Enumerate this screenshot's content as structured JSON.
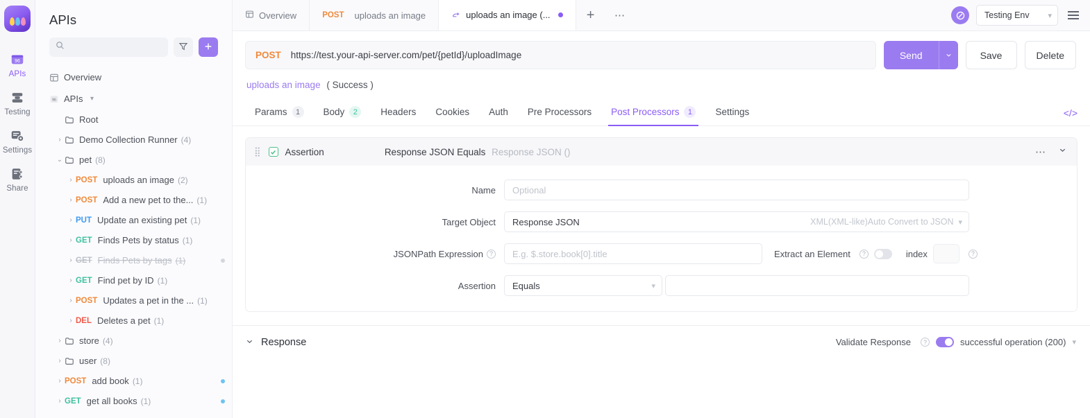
{
  "rail": {
    "items": [
      {
        "label": "APIs",
        "icon": "apis-icon",
        "active": true
      },
      {
        "label": "Testing",
        "icon": "testing-icon",
        "active": false
      },
      {
        "label": "Settings",
        "icon": "settings-icon",
        "active": false
      },
      {
        "label": "Share",
        "icon": "share-icon",
        "active": false
      }
    ]
  },
  "sidebar": {
    "title": "APIs",
    "search_placeholder": "",
    "filter_label": "filter",
    "add_label": "+",
    "overview_label": "Overview",
    "apis_label": "APIs",
    "tree": [
      {
        "label": "Root",
        "count": "",
        "method": "",
        "indent": 0,
        "caret": "",
        "folder": true
      },
      {
        "label": "Demo Collection Runner",
        "count": "(4)",
        "method": "",
        "indent": 0,
        "caret": "›",
        "folder": true
      },
      {
        "label": "pet",
        "count": "(8)",
        "method": "",
        "indent": 0,
        "caret": "⌄",
        "folder": true
      },
      {
        "label": "uploads an image",
        "count": "(2)",
        "method": "POST",
        "indent": 1,
        "caret": "›"
      },
      {
        "label": "Add a new pet to the...",
        "count": "(1)",
        "method": "POST",
        "indent": 1,
        "caret": "›"
      },
      {
        "label": "Update an existing pet",
        "count": "(1)",
        "method": "PUT",
        "indent": 1,
        "caret": "›"
      },
      {
        "label": "Finds Pets by status",
        "count": "(1)",
        "method": "GET",
        "indent": 1,
        "caret": "›"
      },
      {
        "label": "Finds Pets by tags",
        "count": "(1)",
        "method": "GET",
        "indent": 1,
        "caret": "›",
        "muted": true,
        "dot": "grey"
      },
      {
        "label": "Find pet by ID",
        "count": "(1)",
        "method": "GET",
        "indent": 1,
        "caret": "›"
      },
      {
        "label": "Updates a pet in the ...",
        "count": "(1)",
        "method": "POST",
        "indent": 1,
        "caret": "›"
      },
      {
        "label": "Deletes a pet",
        "count": "(1)",
        "method": "DEL",
        "indent": 1,
        "caret": "›"
      },
      {
        "label": "store",
        "count": "(4)",
        "method": "",
        "indent": 0,
        "caret": "›",
        "folder": true
      },
      {
        "label": "user",
        "count": "(8)",
        "method": "",
        "indent": 0,
        "caret": "›",
        "folder": true
      },
      {
        "label": "add book",
        "count": "(1)",
        "method": "POST",
        "indent": 0,
        "caret": "›",
        "dot": "blue"
      },
      {
        "label": "get all books",
        "count": "(1)",
        "method": "GET",
        "indent": 0,
        "caret": "›",
        "dot": "blue"
      }
    ]
  },
  "tabs": {
    "items": [
      {
        "label": "Overview",
        "method": "",
        "icon": "overview-icon",
        "active": false,
        "dirty": false
      },
      {
        "label": "uploads an image",
        "method": "POST",
        "icon": "",
        "active": false,
        "dirty": false
      },
      {
        "label": "uploads an image (...",
        "method": "",
        "icon": "test-case-icon",
        "active": true,
        "dirty": true
      }
    ],
    "new_tab_label": "+",
    "more_label": "⋯"
  },
  "topbar": {
    "env_name": "Testing Env",
    "env_caret": "⌄",
    "menu_label": "menu"
  },
  "request": {
    "method": "POST",
    "url": "https://test.your-api-server.com/pet/{petId}/uploadImage",
    "send_label": "Send",
    "send_caret": "⌄",
    "save_label": "Save",
    "delete_label": "Delete"
  },
  "breadcrumb": {
    "link": "uploads an image",
    "suffix": "( Success )"
  },
  "section_tabs": {
    "items": [
      {
        "label": "Params",
        "badge": "1",
        "badge_style": "grey",
        "active": false
      },
      {
        "label": "Body",
        "badge": "2",
        "badge_style": "green",
        "active": false
      },
      {
        "label": "Headers",
        "badge": "",
        "badge_style": "",
        "active": false
      },
      {
        "label": "Cookies",
        "badge": "",
        "badge_style": "",
        "active": false
      },
      {
        "label": "Auth",
        "badge": "",
        "badge_style": "",
        "active": false
      },
      {
        "label": "Pre Processors",
        "badge": "",
        "badge_style": "",
        "active": false
      },
      {
        "label": "Post Processors",
        "badge": "1",
        "badge_style": "purple",
        "active": true
      },
      {
        "label": "Settings",
        "badge": "",
        "badge_style": "",
        "active": false
      }
    ],
    "code_icon_label": "</>"
  },
  "assertion_card": {
    "title": "Assertion",
    "summary": "Response JSON Equals",
    "summary_dim": "Response JSON ()",
    "more_label": "⋯",
    "collapse_label": "⌄",
    "fields": {
      "name_label": "Name",
      "name_value": "",
      "name_placeholder": "Optional",
      "target_label": "Target Object",
      "target_value": "Response JSON",
      "target_hint": "XML(XML-like)Auto Convert to JSON",
      "jsonpath_label": "JSONPath Expression",
      "jsonpath_value": "",
      "jsonpath_placeholder": "E.g. $.store.book[0].title",
      "extract_label": "Extract an Element",
      "extract_on": false,
      "index_label": "index",
      "index_value": "",
      "assertion_label": "Assertion",
      "assertion_op": "Equals",
      "assertion_value": ""
    }
  },
  "response": {
    "title": "Response",
    "caret": "⌄",
    "validate_label": "Validate Response",
    "validate_on": true,
    "status_option": "successful operation (200)",
    "status_caret": "⌄"
  },
  "colors": {
    "accent": "#8b5cf6",
    "send": "#9b7bf0",
    "post": "#ef8a3b",
    "put": "#3f9af0",
    "get": "#3fc0a0",
    "del": "#ef5b4c"
  }
}
